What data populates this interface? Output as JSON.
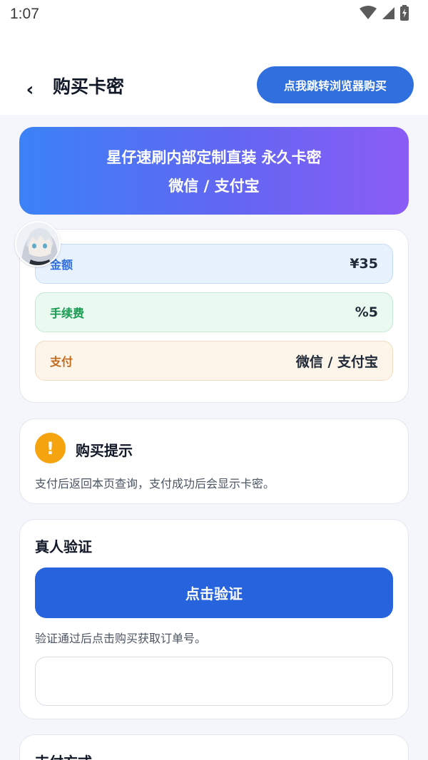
{
  "status_bar": {
    "time": "1:07",
    "icons": [
      "wifi-icon",
      "cell-signal-icon",
      "battery-icon"
    ]
  },
  "header": {
    "back_icon": "chevron-left-icon",
    "back_glyph": "‹",
    "title": "购买卡密",
    "browser_button_label": "点我跳转浏览器购买"
  },
  "banner": {
    "title": "星仔速刷内部定制直装 永久卡密",
    "subtitle": "微信 / 支付宝"
  },
  "info": {
    "avatar": "anime-avatar",
    "rows": [
      {
        "label": "金额",
        "value": "¥35"
      },
      {
        "label": "手续费",
        "value": "%5"
      },
      {
        "label": "支付",
        "value": "微信 / 支付宝"
      }
    ]
  },
  "tip": {
    "icon": "exclamation-icon",
    "icon_glyph": "!",
    "title": "购买提示",
    "text": "支付后返回本页查询，支付成功后会显示卡密。"
  },
  "verify": {
    "title": "真人验证",
    "button_label": "点击验证",
    "hint": "验证通过后点击购买获取订单号。",
    "order_input_value": "",
    "order_input_placeholder": ""
  },
  "payment": {
    "title": "支付方式"
  },
  "colors": {
    "primary": "#2763dd",
    "browser_button": "#2f6fde",
    "banner_gradient_start": "#3b82f6",
    "banner_gradient_end": "#8b5cf6",
    "tip_icon": "#f5a30f",
    "amount_label": "#2f6fde",
    "fee_label": "#17994f",
    "pay_label": "#c26a1c"
  }
}
